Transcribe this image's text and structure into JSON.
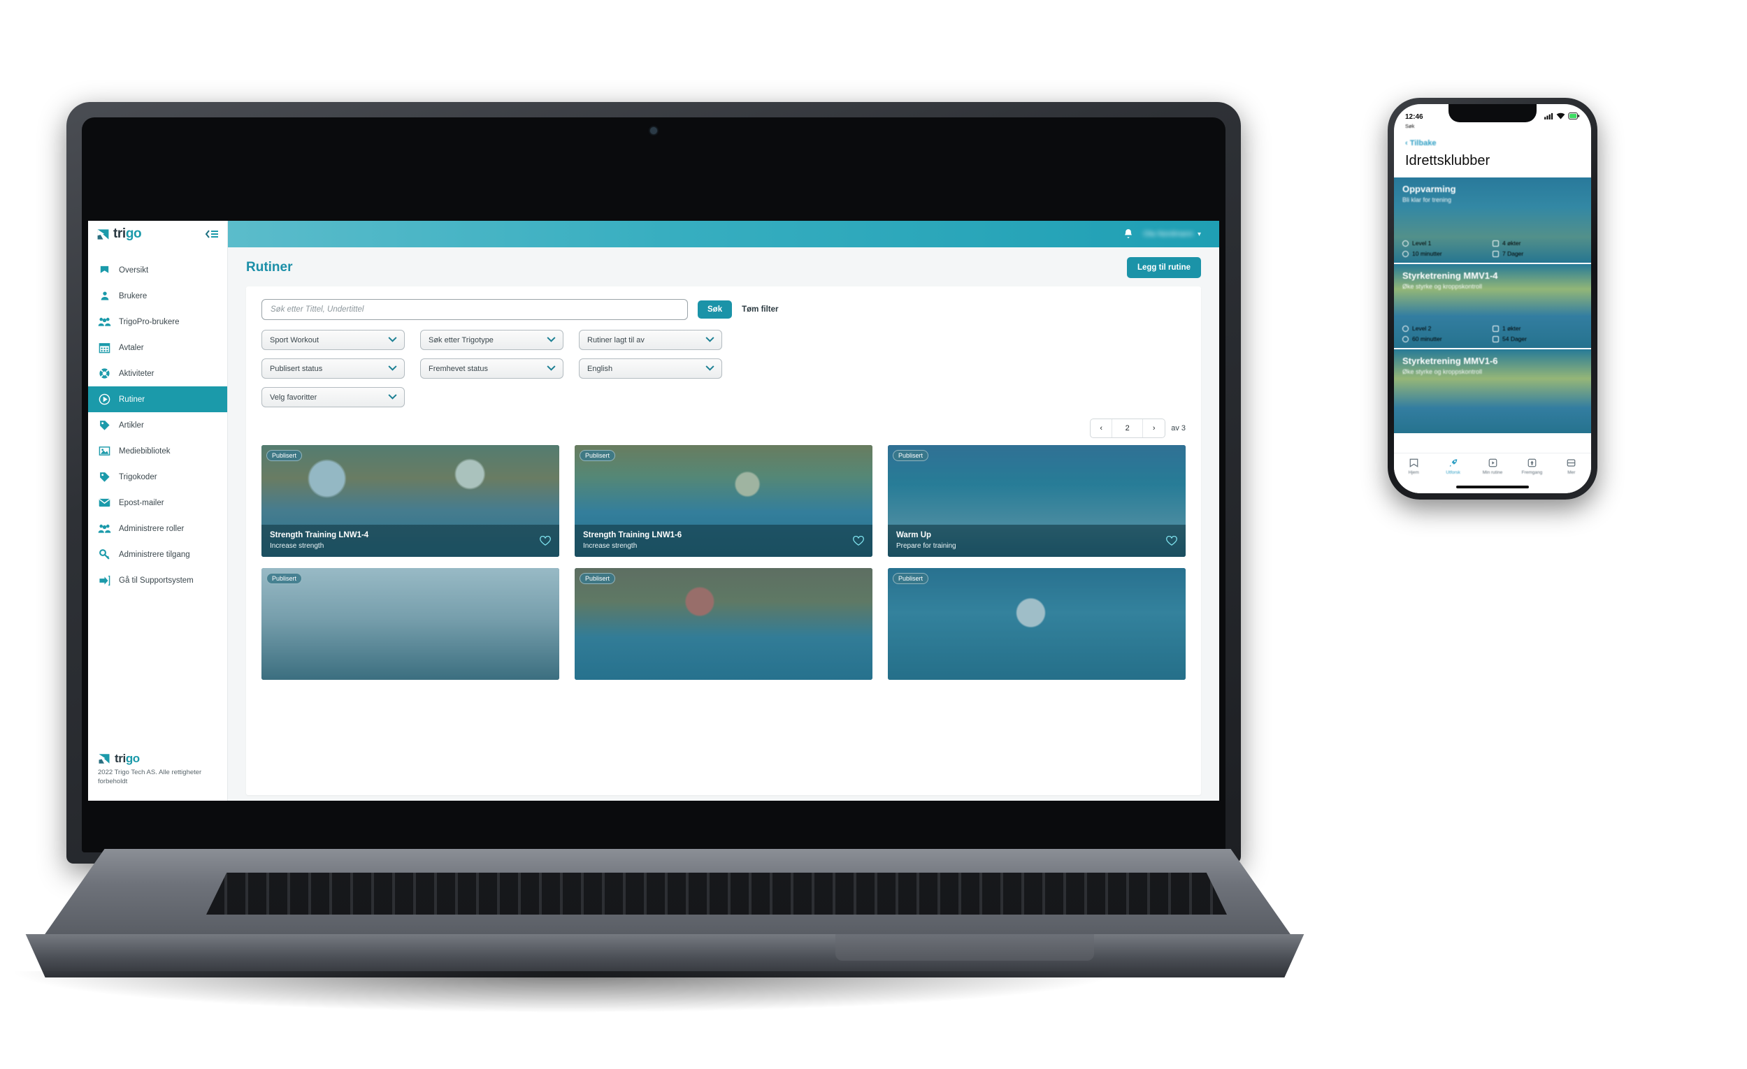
{
  "brand": {
    "name_part1": "tri",
    "name_part2": "go",
    "accent": "#1b9aaa",
    "dark": "#2b3a42"
  },
  "sidebar": {
    "collapse_label": "collapse-sidebar",
    "items": [
      {
        "label": "Oversikt",
        "icon": "bookmark-icon"
      },
      {
        "label": "Brukere",
        "icon": "user-icon"
      },
      {
        "label": "TrigoPro-brukere",
        "icon": "users-group-icon"
      },
      {
        "label": "Avtaler",
        "icon": "calendar-icon"
      },
      {
        "label": "Aktiviteter",
        "icon": "lifebuoy-icon"
      },
      {
        "label": "Rutiner",
        "icon": "play-circle-icon"
      },
      {
        "label": "Artikler",
        "icon": "tag-icon"
      },
      {
        "label": "Mediebibliotek",
        "icon": "image-icon"
      },
      {
        "label": "Trigokoder",
        "icon": "tag-icon"
      },
      {
        "label": "Epost-mailer",
        "icon": "envelope-icon"
      },
      {
        "label": "Administrere roller",
        "icon": "users-group-icon"
      },
      {
        "label": "Administrere tilgang",
        "icon": "key-icon"
      },
      {
        "label": "Gå til Supportsystem",
        "icon": "login-arrow-icon"
      }
    ],
    "active_index": 5,
    "footer_copyright": "2022 Trigo Tech AS. Alle rettigheter forbeholdt"
  },
  "topbar": {
    "bell_icon": "bell-icon",
    "user_name": "Ola Nordmann",
    "caret_icon": "chevron-down-icon"
  },
  "page": {
    "title": "Rutiner",
    "add_button": "Legg til rutine",
    "search": {
      "placeholder": "Søk etter Tittel, Undertittel",
      "value": ""
    },
    "search_button": "Søk",
    "clear_filter": "Tøm filter",
    "filters": [
      {
        "label": "Sport Workout"
      },
      {
        "label": "Søk etter Trigotype"
      },
      {
        "label": "Rutiner lagt til av"
      },
      {
        "label": "Publisert status"
      },
      {
        "label": "Fremhevet status"
      },
      {
        "label": "English"
      },
      {
        "label": "Velg favoritter"
      }
    ],
    "pagination": {
      "prev": "‹",
      "page": "2",
      "next": "›",
      "of_label": "av 3"
    },
    "cards": [
      {
        "badge": "Publisert",
        "title": "Strength Training LNW1-4",
        "subtitle": "Increase strength",
        "photo": "ph-a",
        "favorite_icon": "heart-icon"
      },
      {
        "badge": "Publisert",
        "title": "Strength Training LNW1-6",
        "subtitle": "Increase strength",
        "photo": "ph-b",
        "favorite_icon": "heart-icon"
      },
      {
        "badge": "Publisert",
        "title": "Warm Up",
        "subtitle": "Prepare for training",
        "photo": "ph-c",
        "favorite_icon": "heart-icon"
      },
      {
        "badge": "Publisert",
        "title": "",
        "subtitle": "",
        "photo": "ph-d",
        "favorite_icon": "heart-icon"
      },
      {
        "badge": "Publisert",
        "title": "",
        "subtitle": "",
        "photo": "ph-e",
        "favorite_icon": "heart-icon"
      },
      {
        "badge": "Publisert",
        "title": "",
        "subtitle": "",
        "photo": "ph-f",
        "favorite_icon": "heart-icon"
      }
    ]
  },
  "phone": {
    "status": {
      "time": "12:46",
      "carrier": "Søk",
      "signal_icon": "signal-icon",
      "wifi_icon": "wifi-icon",
      "battery_icon": "battery-icon"
    },
    "back_label": "Tilbake",
    "title": "Idrettsklubber",
    "cards": [
      {
        "title": "Oppvarming",
        "subtitle": "Bli klar for trening",
        "level": "Level 1",
        "duration": "10 minutter",
        "sessions": "4 økter",
        "days": "7 Dager",
        "photo": "pmc-a"
      },
      {
        "title": "Styrketrening MMV1-4",
        "subtitle": "Øke styrke og kroppskontroll",
        "level": "Level 2",
        "duration": "60 minutter",
        "sessions": "1 økter",
        "days": "54 Dager",
        "photo": "pmc-b"
      },
      {
        "title": "Styrketrening MMV1-6",
        "subtitle": "Øke styrke og kroppskontroll",
        "level": "",
        "duration": "",
        "sessions": "",
        "days": "",
        "photo": "pmc-c"
      }
    ],
    "nav": [
      {
        "label": "Hjem",
        "icon": "home-icon"
      },
      {
        "label": "Utforsk",
        "icon": "rocket-icon"
      },
      {
        "label": "Min rutine",
        "icon": "play-box-icon"
      },
      {
        "label": "Fremgang",
        "icon": "progress-icon"
      },
      {
        "label": "Mer",
        "icon": "menu-icon"
      }
    ],
    "nav_active_index": 1
  }
}
